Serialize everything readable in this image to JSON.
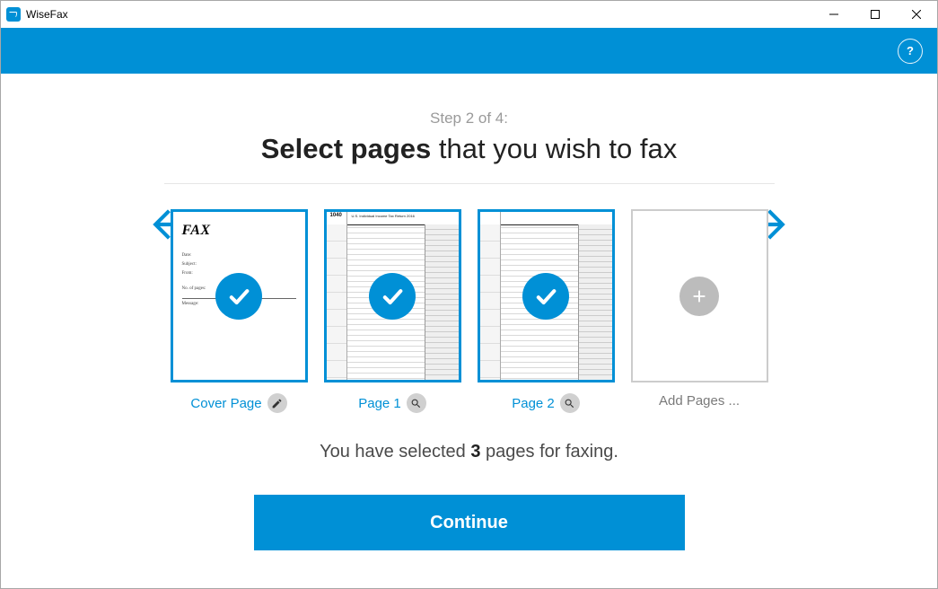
{
  "window": {
    "title": "WiseFax"
  },
  "topbar": {
    "help_symbol": "?"
  },
  "wizard": {
    "step_label": "Step 2 of 4:",
    "heading_bold": "Select pages",
    "heading_rest": " that you wish to fax"
  },
  "thumbs": {
    "cover": {
      "label": "Cover Page",
      "fax_heading": "FAX"
    },
    "page1": {
      "label": "Page 1",
      "form_no": "1040",
      "form_desc": "U.S. Individual Income Tax Return    2016"
    },
    "page2": {
      "label": "Page 2",
      "form_no": "",
      "form_desc": ""
    },
    "add": {
      "label": "Add Pages ..."
    }
  },
  "status": {
    "prefix": "You have selected ",
    "count": "3",
    "suffix": " pages for faxing."
  },
  "actions": {
    "continue": "Continue"
  }
}
